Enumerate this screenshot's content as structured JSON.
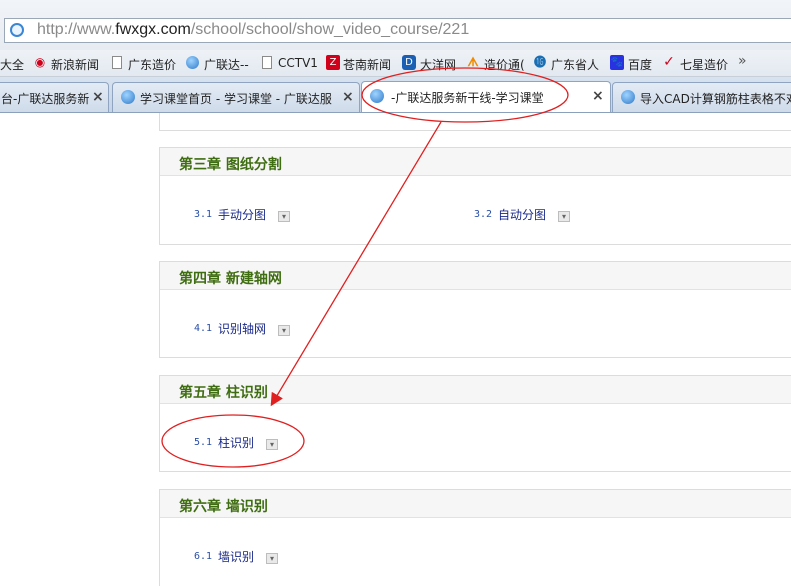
{
  "address_bar": {
    "url_prefix": "http://www.",
    "url_domain": "fwxgx.com",
    "url_path": "/school/school/show_video_course/221"
  },
  "bookmarks": [
    {
      "label": "大全",
      "icon": "none"
    },
    {
      "label": "新浪新闻",
      "icon": "weibo-icon"
    },
    {
      "label": "广东造价",
      "icon": "page-icon"
    },
    {
      "label": "广联达--",
      "icon": "glodon-icon"
    },
    {
      "label": "CCTV1",
      "icon": "page-icon"
    },
    {
      "label": "苍南新闻",
      "icon": "news-icon"
    },
    {
      "label": "大洋网",
      "icon": "dayoo-icon"
    },
    {
      "label": "造价通(",
      "icon": "zjt-icon"
    },
    {
      "label": "广东省人",
      "icon": "gov-icon"
    },
    {
      "label": "百度",
      "icon": "baidu-icon"
    },
    {
      "label": "七星造价",
      "icon": "check-icon"
    }
  ],
  "bookmarks_more": "»",
  "tabs": [
    {
      "label": "台-广联达服务新",
      "close": "×"
    },
    {
      "label": "学习课堂首页 - 学习课堂 - 广联达服",
      "close": "×"
    },
    {
      "label": "-广联达服务新干线-学习课堂",
      "close": "×"
    },
    {
      "label": "导入CAD计算钢筋柱表格不对",
      "close": ""
    }
  ],
  "chapters": [
    {
      "title": "第三章 图纸分割",
      "lessons": [
        {
          "num": "3.1",
          "label": "手动分图"
        },
        {
          "num": "3.2",
          "label": "自动分图"
        }
      ]
    },
    {
      "title": "第四章 新建轴网",
      "lessons": [
        {
          "num": "4.1",
          "label": "识别轴网"
        }
      ]
    },
    {
      "title": "第五章 柱识别",
      "lessons": [
        {
          "num": "5.1",
          "label": "柱识别"
        }
      ]
    },
    {
      "title": "第六章 墙识别",
      "lessons": [
        {
          "num": "6.1",
          "label": "墙识别"
        }
      ]
    }
  ],
  "colors": {
    "chapter_title": "#3f6d11",
    "lesson_label": "#1a2a8a",
    "annotation": "#e02020"
  }
}
